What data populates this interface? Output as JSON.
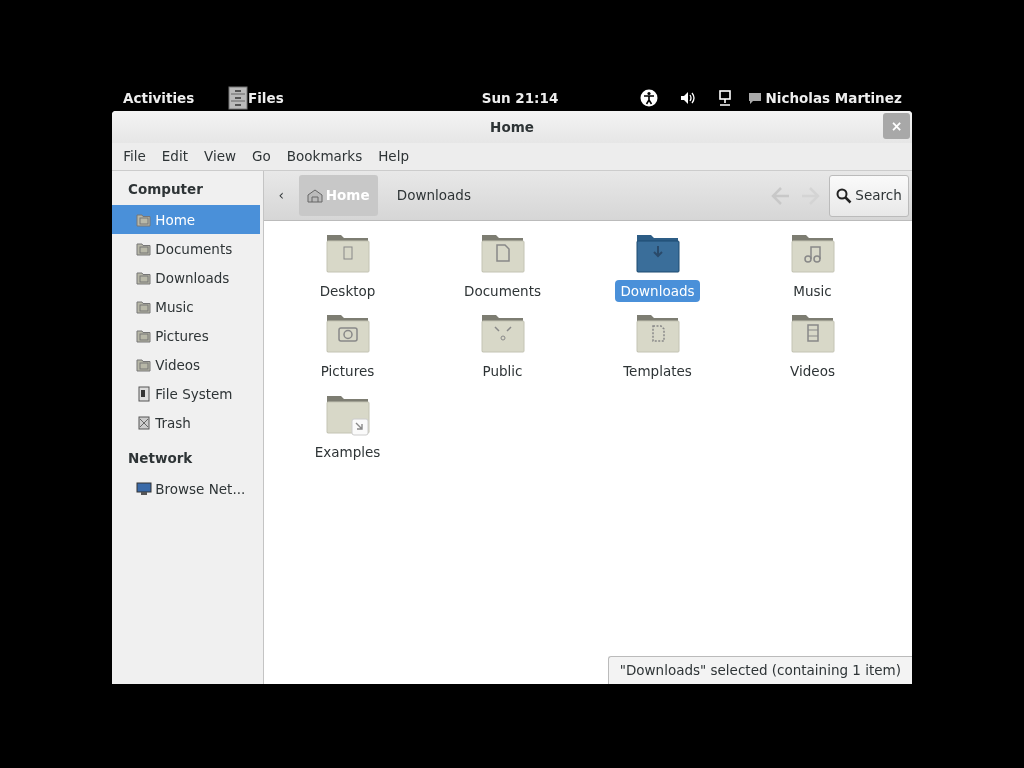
{
  "top_bar": {
    "activities": "Activities",
    "app_name": "Files",
    "clock": "Sun 21:14",
    "user_name": "Nicholas Martinez"
  },
  "window": {
    "title": "Home",
    "close": "×"
  },
  "menu": [
    "File",
    "Edit",
    "View",
    "Go",
    "Bookmarks",
    "Help"
  ],
  "sidebar": {
    "sections": [
      {
        "title": "Computer",
        "items": [
          {
            "label": "Home",
            "selected": true
          },
          {
            "label": "Documents",
            "selected": false
          },
          {
            "label": "Downloads",
            "selected": false
          },
          {
            "label": "Music",
            "selected": false
          },
          {
            "label": "Pictures",
            "selected": false
          },
          {
            "label": "Videos",
            "selected": false
          },
          {
            "label": "File System",
            "selected": false
          },
          {
            "label": "Trash",
            "selected": false
          }
        ]
      },
      {
        "title": "Network",
        "items": [
          {
            "label": "Browse Net...",
            "selected": false
          }
        ]
      }
    ]
  },
  "toolbar": {
    "back_arrow": "‹",
    "path": [
      {
        "label": "Home",
        "selected": true
      },
      {
        "label": "Downloads",
        "selected": false
      }
    ],
    "search": "Search"
  },
  "files": [
    {
      "name": "Desktop",
      "selected": false
    },
    {
      "name": "Documents",
      "selected": false
    },
    {
      "name": "Downloads",
      "selected": true
    },
    {
      "name": "Music",
      "selected": false
    },
    {
      "name": "Pictures",
      "selected": false
    },
    {
      "name": "Public",
      "selected": false
    },
    {
      "name": "Templates",
      "selected": false
    },
    {
      "name": "Videos",
      "selected": false
    },
    {
      "name": "Examples",
      "selected": false
    }
  ],
  "status": "\"Downloads\" selected (containing 1 item)"
}
